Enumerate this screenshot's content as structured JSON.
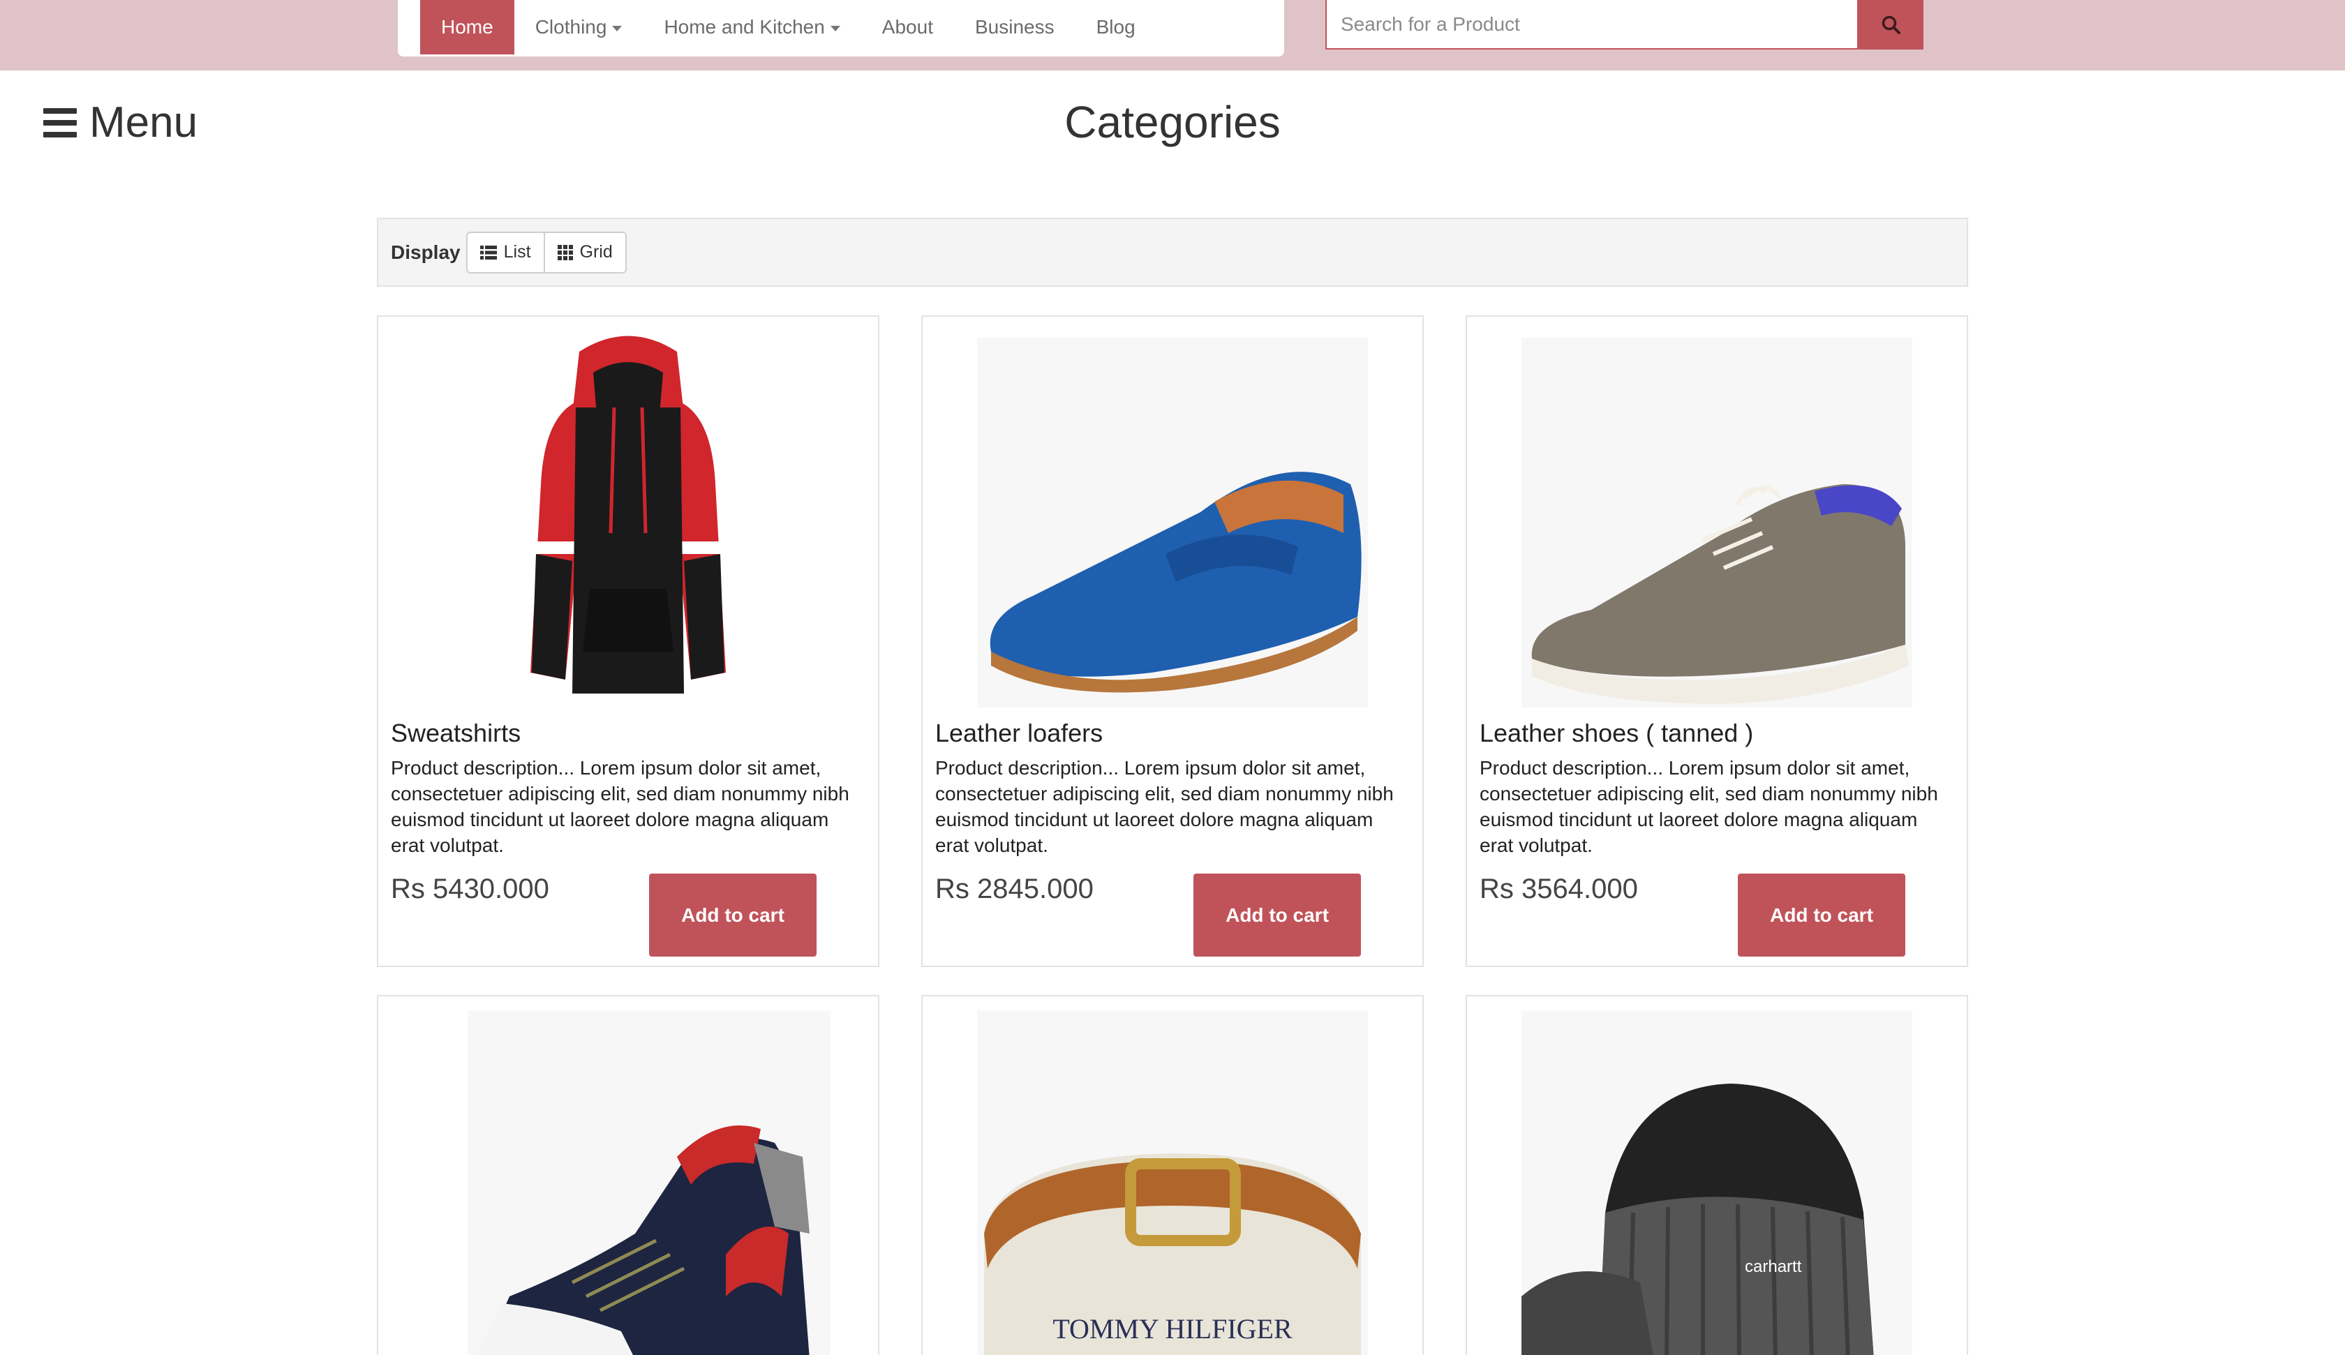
{
  "nav": {
    "items": [
      {
        "label": "Home"
      },
      {
        "label": "Clothing"
      },
      {
        "label": "Home and Kitchen"
      },
      {
        "label": "About"
      },
      {
        "label": "Business"
      },
      {
        "label": "Blog"
      }
    ],
    "active": "Home"
  },
  "search": {
    "placeholder": "Search for a Product",
    "icon": "search-icon"
  },
  "menu": {
    "label": "Menu",
    "icon": "hamburger-icon"
  },
  "page": {
    "title": "Categories"
  },
  "display": {
    "label": "Display",
    "options": [
      {
        "label": "List",
        "icon": "list-icon"
      },
      {
        "label": "Grid",
        "icon": "grid-icon"
      }
    ]
  },
  "products": [
    {
      "name": "Sweatshirts",
      "description": "Product description... Lorem ipsum dolor sit amet, consectetuer adipiscing elit, sed diam nonummy nibh euismod tincidunt ut laoreet dolore magna aliquam erat volutpat.",
      "price": "Rs 5430.000",
      "button": "Add to cart",
      "image": "red-black-hoodie"
    },
    {
      "name": "Leather loafers",
      "description": "Product description... Lorem ipsum dolor sit amet, consectetuer adipiscing elit, sed diam nonummy nibh euismod tincidunt ut laoreet dolore magna aliquam erat volutpat.",
      "price": "Rs 2845.000",
      "button": "Add to cart",
      "image": "blue-leather-loafer"
    },
    {
      "name": "Leather shoes ( tanned )",
      "description": "Product description... Lorem ipsum dolor sit amet, consectetuer adipiscing elit, sed diam nonummy nibh euismod tincidunt ut laoreet dolore magna aliquam erat volutpat.",
      "price": "Rs 3564.000",
      "button": "Add to cart",
      "image": "tan-lace-up-shoe"
    },
    {
      "image": "high-top-sneaker"
    },
    {
      "image": "brown-leather-belt",
      "image_text": "TOMMY HILFIGER"
    },
    {
      "image": "knit-beanie-cap",
      "image_text": "carhartt"
    }
  ],
  "colors": {
    "accent": "#c0535a",
    "topbar": "#e0c3c8"
  }
}
